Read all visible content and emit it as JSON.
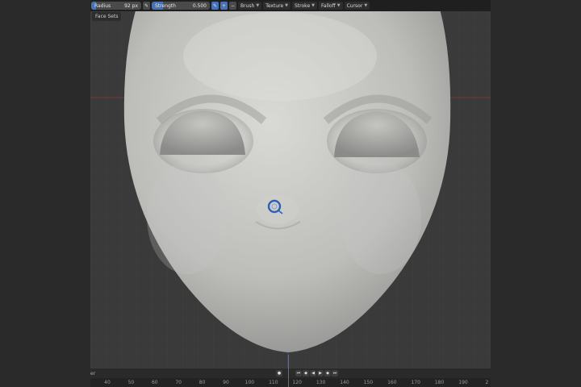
{
  "header": {
    "radius_label": "Radius",
    "radius_value": "92 px",
    "strength_label": "Strength",
    "strength_value": "0.500",
    "strength_fraction": 0.5,
    "plus_label": "+",
    "minus_label": "−",
    "menus": [
      "Brush",
      "Texture",
      "Stroke",
      "Falloff",
      "Cursor"
    ]
  },
  "viewport": {
    "tab_label": "Face Sets"
  },
  "timeline": {
    "left_label": "er",
    "ruler_ticks": [
      "40",
      "50",
      "60",
      "70",
      "80",
      "90",
      "100",
      "110",
      "120",
      "130",
      "140",
      "150",
      "160",
      "170",
      "180",
      "190",
      "2"
    ]
  },
  "colors": {
    "accent": "#4772b3",
    "viewport_bg": "#3a3a3a",
    "header_bg": "#1f1f1f"
  }
}
